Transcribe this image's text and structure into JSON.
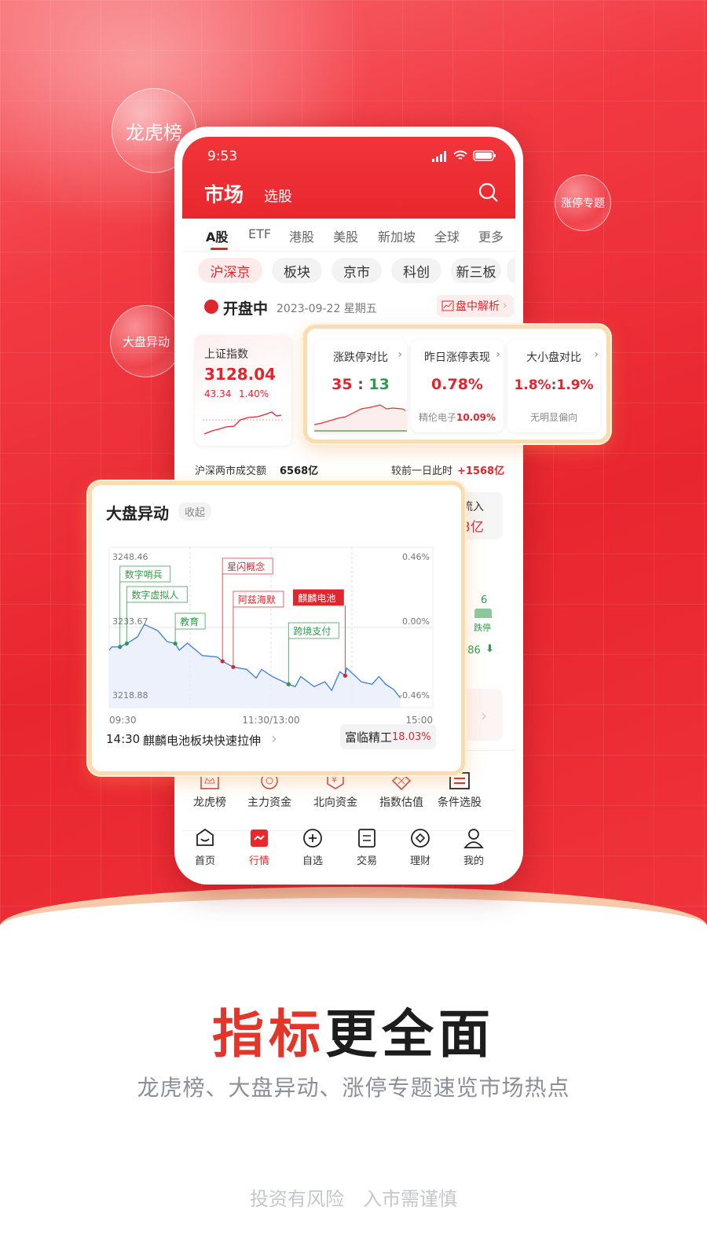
{
  "promo": {
    "bubbles": [
      "龙虎榜",
      "涨停专题",
      "大盘异动"
    ],
    "headline_accent": "指标",
    "headline_rest": "更全面",
    "subtitle": "龙虎榜、大盘异动、涨停专题速览市场热点",
    "disclaimer": "投资有风险　入市需谨慎",
    "accent_color": "#e4352a"
  },
  "status_bar": {
    "time": "9:53",
    "icons": [
      "signal-icon",
      "wifi-icon",
      "battery-icon"
    ]
  },
  "header": {
    "title": "市场",
    "subtitle_tab": "选股",
    "search_icon": "search-icon"
  },
  "market_tabs": {
    "items": [
      "A股",
      "ETF",
      "港股",
      "美股",
      "新加坡",
      "全球",
      "更多"
    ],
    "active": "A股"
  },
  "chips": {
    "items": [
      "沪深京",
      "板块",
      "京市",
      "科创",
      "新三板"
    ],
    "active": "沪深京"
  },
  "session": {
    "status": "开盘中",
    "date": "2023-09-22 星期五",
    "analysis_button": "盘中解析"
  },
  "index_card": {
    "name": "上证指数",
    "value": "3128.04",
    "change": "43.34",
    "change_pct": "1.40%"
  },
  "highlight_cards": [
    {
      "title": "涨跌停对比",
      "up": "35",
      "sep": ":",
      "down": "13"
    },
    {
      "title": "昨日涨停表现",
      "value": "0.78%",
      "stock": "精伦电子",
      "stock_pct": "10.09%"
    },
    {
      "title": "大小盘对比",
      "big": "1.8%",
      "sep": ":",
      "small": "1.9%",
      "note": "无明显偏向"
    }
  ],
  "turnover": {
    "label": "沪深两市成交额",
    "value": "6568亿",
    "compare_label": "较前一日此时",
    "compare_value": "+1568亿"
  },
  "hidden_peek": {
    "inflow_label": "流入",
    "inflow_value": "3亿",
    "count": "6",
    "count_label": "跌停",
    "fall_count": "986"
  },
  "anomaly_card": {
    "title": "大盘异动",
    "collapse_button": "收起",
    "footer_time": "14:30",
    "footer_text": "麒麟电池板块快速拉伸",
    "stock_name": "富临精工",
    "stock_pct": "18.03%"
  },
  "chart_data": {
    "type": "line",
    "y_left_ticks": [
      "3248.46",
      "3233.67",
      "3218.88"
    ],
    "y_right_ticks": [
      "0.46%",
      "0.00%",
      "-0.46%"
    ],
    "x_ticks": [
      "09:30",
      "11:30/13:00",
      "15:00"
    ],
    "ylim": [
      3218.88,
      3248.46
    ],
    "line_color": "#3b7be0",
    "points": [
      [
        "09:30",
        3228.9
      ],
      [
        "09:32",
        3229.6
      ],
      [
        "09:38",
        3229.6
      ],
      [
        "09:43",
        3230.3
      ],
      [
        "09:51",
        3231.7
      ],
      [
        "09:56",
        3234.3
      ],
      [
        "10:06",
        3233.0
      ],
      [
        "10:13",
        3230.7
      ],
      [
        "10:19",
        3230.3
      ],
      [
        "10:22",
        3228.9
      ],
      [
        "10:28",
        3230.4
      ],
      [
        "10:39",
        3227.8
      ],
      [
        "10:50",
        3227.5
      ],
      [
        "10:54",
        3226.6
      ],
      [
        "11:02",
        3225.4
      ],
      [
        "11:12",
        3224.9
      ],
      [
        "11:19",
        3223.1
      ],
      [
        "11:23",
        3224.9
      ],
      [
        "13:01",
        3223.4
      ],
      [
        "13:13",
        3221.8
      ],
      [
        "13:18",
        3221.3
      ],
      [
        "13:22",
        3223.4
      ],
      [
        "13:32",
        3221.3
      ],
      [
        "13:40",
        3222.3
      ],
      [
        "13:45",
        3220.5
      ],
      [
        "13:51",
        3224.4
      ],
      [
        "13:55",
        3223.6
      ],
      [
        "13:56",
        3225.2
      ],
      [
        "14:07",
        3222.3
      ],
      [
        "14:15",
        3221.8
      ],
      [
        "14:20",
        3223.4
      ],
      [
        "14:25",
        3221.8
      ],
      [
        "14:31",
        3220.7
      ],
      [
        "14:36",
        3218.9
      ]
    ],
    "events": [
      {
        "label": "数字哨兵",
        "time": "09:38",
        "value": 3229.6,
        "direction": "up",
        "color": "#2f9a4b"
      },
      {
        "label": "数字虚拟人",
        "time": "09:43",
        "value": 3230.3,
        "direction": "up",
        "color": "#2f9a4b"
      },
      {
        "label": "教育",
        "time": "10:19",
        "value": 3230.3,
        "direction": "up",
        "color": "#2f9a4b"
      },
      {
        "label": "星闪概念",
        "time": "10:54",
        "value": 3226.6,
        "direction": "down",
        "color": "#e0262d"
      },
      {
        "label": "阿兹海默",
        "time": "11:02",
        "value": 3225.4,
        "direction": "down",
        "color": "#e0262d"
      },
      {
        "label": "跨境支付",
        "time": "13:13",
        "value": 3221.8,
        "direction": "up",
        "color": "#2f9a4b"
      },
      {
        "label": "麒麟电池",
        "time": "13:55",
        "value": 3223.6,
        "direction": "down",
        "color": "#e0262d",
        "selected": true
      }
    ]
  },
  "shortcuts": [
    {
      "label": "龙虎榜",
      "icon": "crown-icon"
    },
    {
      "label": "主力资金",
      "icon": "target-icon"
    },
    {
      "label": "北向资金",
      "icon": "yuan-shield-icon"
    },
    {
      "label": "指数估值",
      "icon": "valuation-icon"
    },
    {
      "label": "条件选股",
      "icon": "filter-icon"
    }
  ],
  "tab_bar": {
    "items": [
      {
        "label": "首页",
        "icon": "home-icon"
      },
      {
        "label": "行情",
        "icon": "market-icon"
      },
      {
        "label": "自选",
        "icon": "plus-circle-icon"
      },
      {
        "label": "交易",
        "icon": "trade-icon"
      },
      {
        "label": "理财",
        "icon": "wealth-icon"
      },
      {
        "label": "我的",
        "icon": "user-icon"
      }
    ],
    "active": "行情"
  }
}
